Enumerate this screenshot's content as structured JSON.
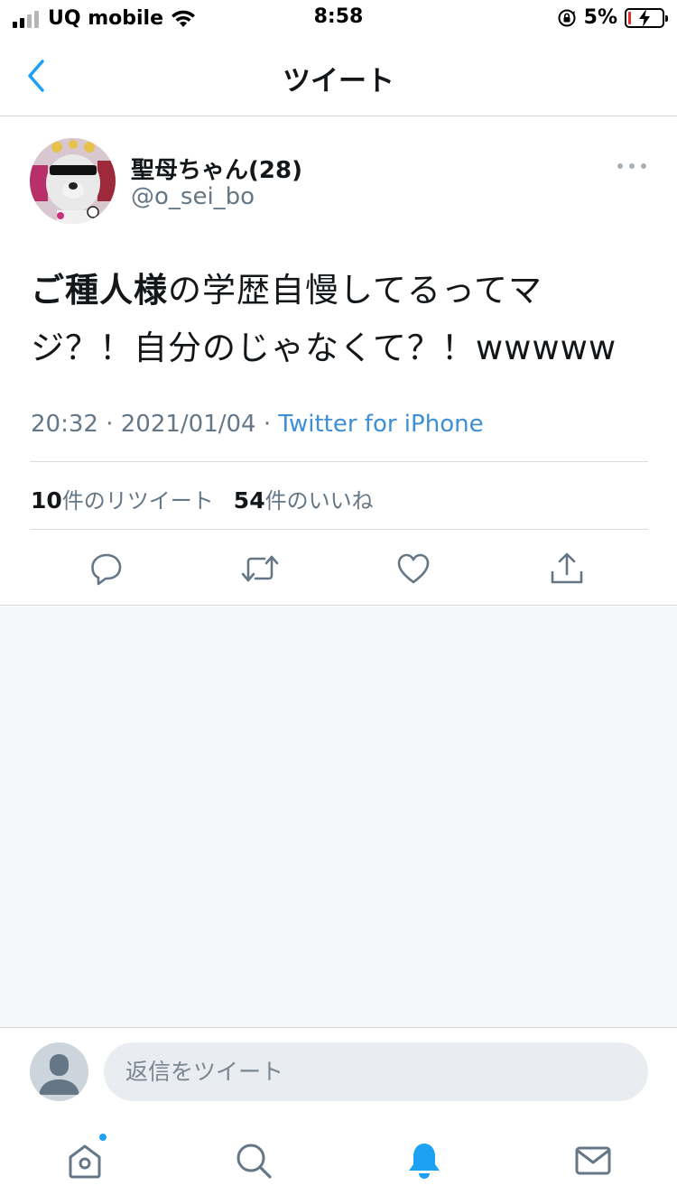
{
  "status_bar": {
    "carrier": "UQ mobile",
    "time": "8:58",
    "battery_percent": "5%",
    "battery_level": 0.05
  },
  "nav": {
    "title": "ツイート"
  },
  "tweet": {
    "display_name": "聖母ちゃん(28)",
    "handle": "@o_sei_bo",
    "text_bold": "ご種人様",
    "text_line1_rest": "の学歴自慢してるってマ",
    "text_line2": "ジ？！自分のじゃなくて？！wwwww",
    "time": "20:32",
    "date": "2021/01/04",
    "separator": "·",
    "source": "Twitter for iPhone",
    "retweet_count": "10",
    "retweet_label": "件のリツイート",
    "like_count": "54",
    "like_label": "件のいいね"
  },
  "reply": {
    "placeholder": "返信をツイート"
  },
  "colors": {
    "accent": "#1da1f2",
    "link": "#3d8fd6",
    "secondary_text": "#657786",
    "background_gray": "#f5f7f9"
  }
}
